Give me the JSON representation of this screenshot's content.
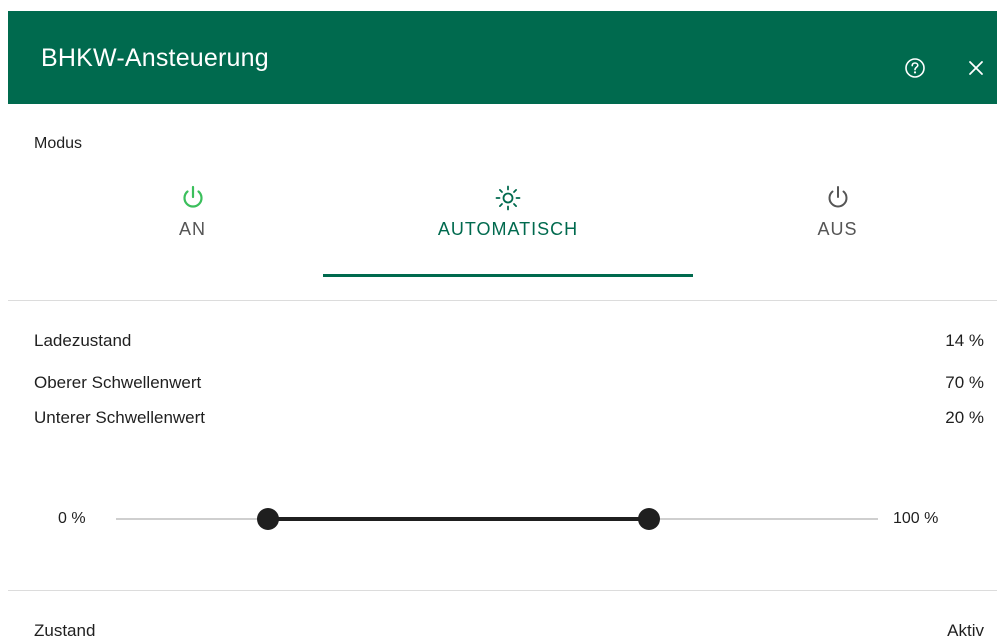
{
  "dialog": {
    "title": "BHKW-Ansteuerung"
  },
  "mode": {
    "label": "Modus",
    "selected": "AUTOMATISCH",
    "options": [
      {
        "label": "AN",
        "icon": "power-icon",
        "icon_color": "#3bbf5c"
      },
      {
        "label": "AUTOMATISCH",
        "icon": "sun-icon",
        "icon_color": "#006a4e"
      },
      {
        "label": "AUS",
        "icon": "power-icon",
        "icon_color": "#555555"
      }
    ]
  },
  "values": {
    "ladezustand": {
      "label": "Ladezustand",
      "value": "14 %"
    },
    "oberer": {
      "label": "Oberer Schwellenwert",
      "value": "70 %"
    },
    "unterer": {
      "label": "Unterer Schwellenwert",
      "value": "20 %"
    }
  },
  "slider": {
    "min_label": "0 %",
    "max_label": "100 %",
    "low": 20,
    "high": 70
  },
  "status": {
    "label": "Zustand",
    "value": "Aktiv"
  },
  "colors": {
    "brand": "#006a4e",
    "on": "#3bbf5c"
  }
}
